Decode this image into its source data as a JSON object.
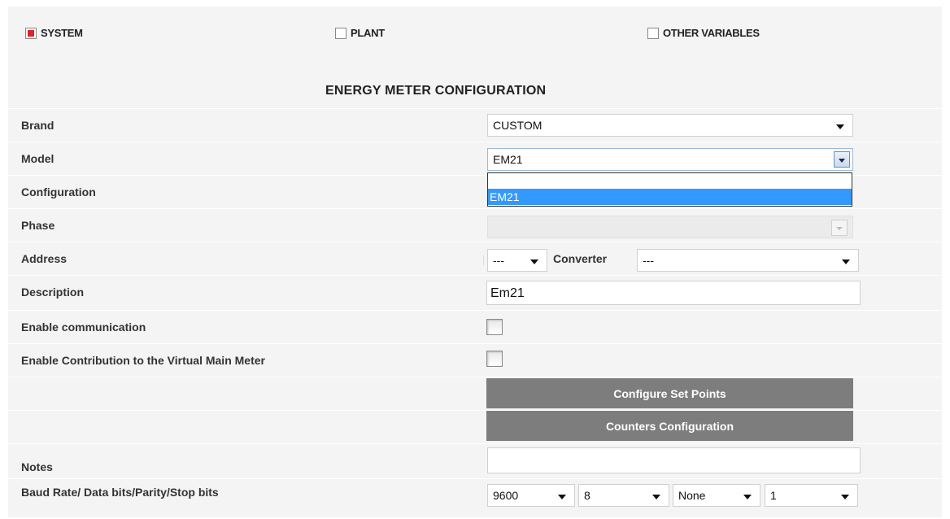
{
  "tabs": {
    "system": {
      "label": "SYSTEM",
      "checked": true
    },
    "plant": {
      "label": "PLANT",
      "checked": false
    },
    "other": {
      "label": "OTHER VARIABLES",
      "checked": false
    }
  },
  "heading": "ENERGY METER CONFIGURATION",
  "fields": {
    "brand": {
      "label": "Brand",
      "value": "CUSTOM"
    },
    "model": {
      "label": "Model",
      "value": "EM21",
      "options": [
        "",
        "EM21"
      ],
      "highlighted": "EM21"
    },
    "configuration": {
      "label": "Configuration"
    },
    "phase": {
      "label": "Phase",
      "value": ""
    },
    "address": {
      "label": "Address",
      "value": "---",
      "converter_label": "Converter",
      "converter_value": "---"
    },
    "description": {
      "label": "Description",
      "value": "Em21"
    },
    "enable_communication": {
      "label": "Enable communication",
      "checked": false
    },
    "enable_contribution": {
      "label": "Enable Contribution to the Virtual Main Meter",
      "checked": false
    },
    "notes": {
      "label": "Notes",
      "value": ""
    },
    "serial": {
      "label": "Baud Rate/ Data bits/Parity/Stop bits",
      "baud": "9600",
      "data_bits": "8",
      "parity": "None",
      "stop_bits": "1"
    }
  },
  "buttons": {
    "set_points": "Configure Set Points",
    "counters": "Counters Configuration"
  },
  "colors": {
    "accent_red": "#e0202a",
    "button_gray": "#7d7d7d",
    "highlight_blue": "#3399ff"
  }
}
